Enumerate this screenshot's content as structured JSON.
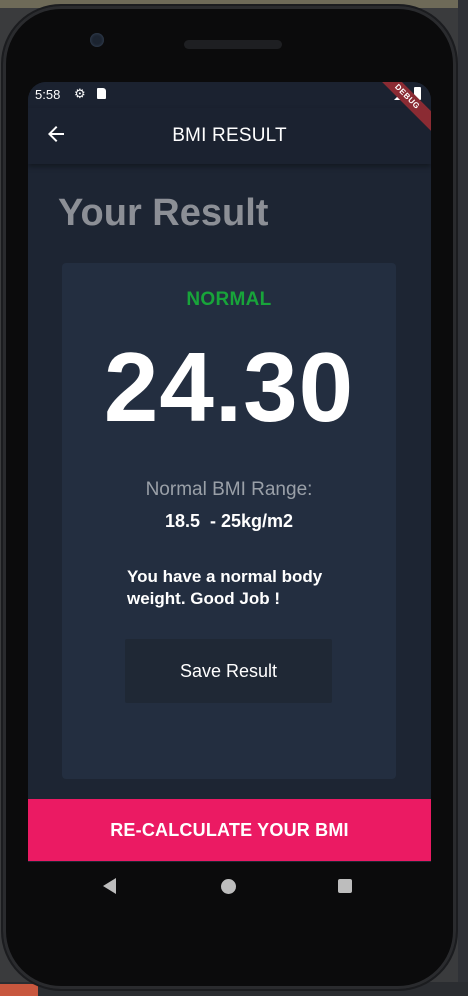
{
  "status_bar": {
    "time": "5:58",
    "debug_label": "DEBUG"
  },
  "app_bar": {
    "title": "BMI RESULT"
  },
  "page": {
    "title": "Your Result"
  },
  "result": {
    "status": "NORMAL",
    "status_color": "#18a43a",
    "bmi": "24.30",
    "range_label": "Normal BMI Range:",
    "range_value": "18.5  - 25kg/m2",
    "advice": "You have a normal body weight. Good Job !",
    "save_label": "Save Result"
  },
  "footer": {
    "recalculate_label": "RE-CALCULATE YOUR BMI",
    "accent_color": "#eb1a63"
  },
  "nav": {
    "icons": [
      "back-triangle-icon",
      "home-circle-icon",
      "recents-square-icon"
    ]
  }
}
